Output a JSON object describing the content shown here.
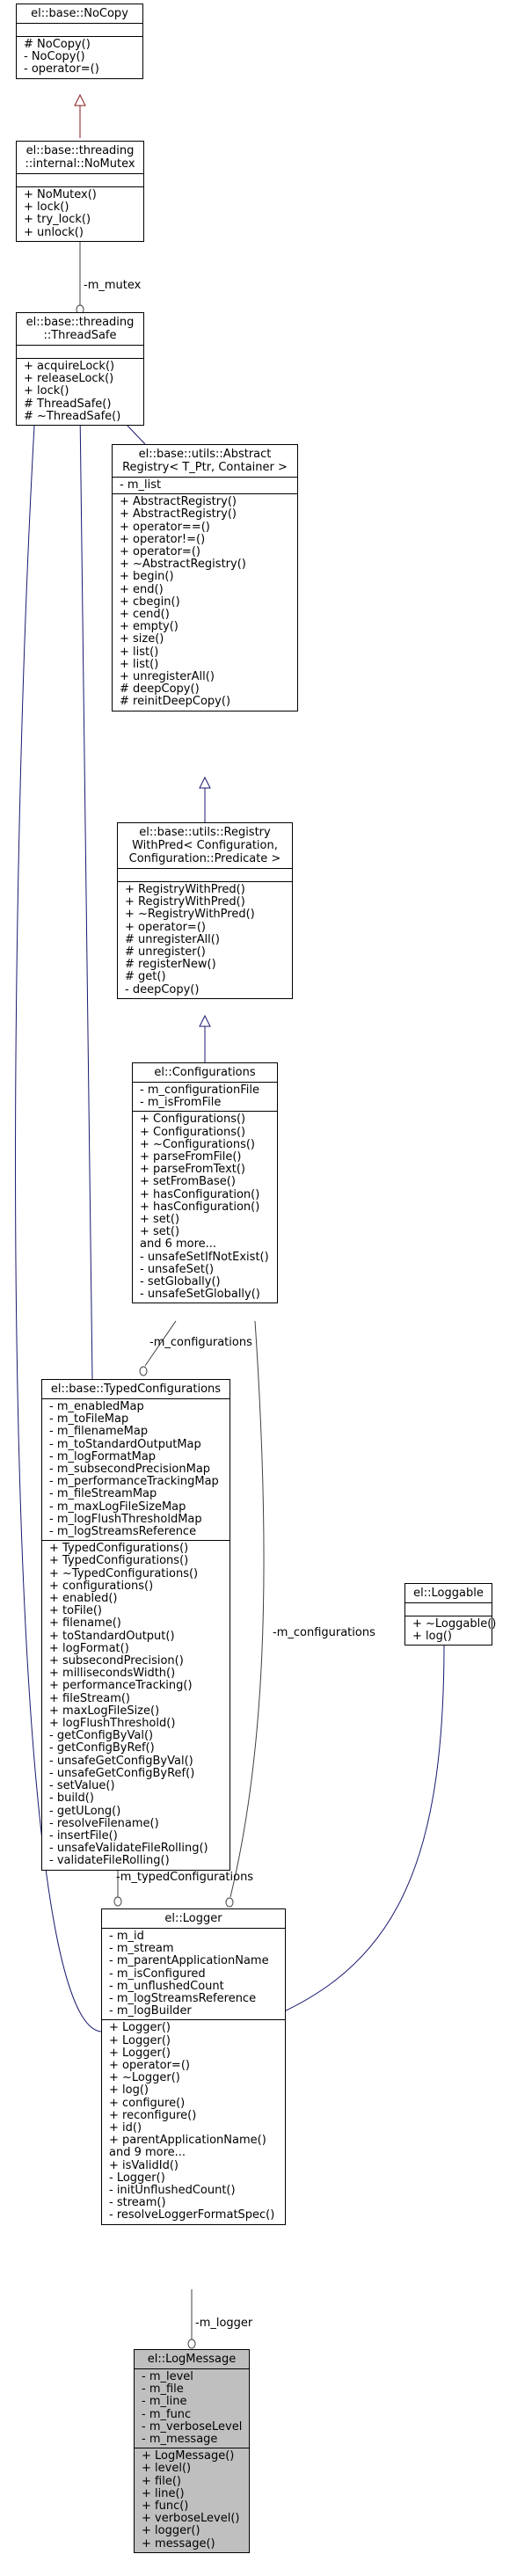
{
  "classes": {
    "nocopy": {
      "title": [
        "el::base::NoCopy"
      ],
      "attributes": [],
      "operations": [
        "# NoCopy()",
        "- NoCopy()",
        "- operator=()"
      ]
    },
    "nomutex": {
      "title": [
        "el::base::threading",
        "::internal::NoMutex"
      ],
      "attributes": [],
      "operations": [
        "+ NoMutex()",
        "+ lock()",
        "+ try_lock()",
        "+ unlock()"
      ]
    },
    "threadsafe": {
      "title": [
        "el::base::threading",
        "::ThreadSafe"
      ],
      "attributes": [],
      "operations": [
        "+ acquireLock()",
        "+ releaseLock()",
        "+ lock()",
        "# ThreadSafe()",
        "# ~ThreadSafe()"
      ]
    },
    "abstractregistry": {
      "title": [
        "el::base::utils::Abstract",
        "Registry< T_Ptr, Container >"
      ],
      "attributes": [
        "- m_list"
      ],
      "operations": [
        "+ AbstractRegistry()",
        "+ AbstractRegistry()",
        "+ operator==()",
        "+ operator!=()",
        "+ operator=()",
        "+ ~AbstractRegistry()",
        "+ begin()",
        "+ end()",
        "+ cbegin()",
        "+ cend()",
        "+ empty()",
        "+ size()",
        "+ list()",
        "+ list()",
        "+ unregisterAll()",
        "# deepCopy()",
        "# reinitDeepCopy()"
      ]
    },
    "registrywithpred": {
      "title": [
        "el::base::utils::Registry",
        "WithPred< Configuration,",
        "Configuration::Predicate >"
      ],
      "attributes": [],
      "operations": [
        "+ RegistryWithPred()",
        "+ RegistryWithPred()",
        "+ ~RegistryWithPred()",
        "+ operator=()",
        "# unregisterAll()",
        "# unregister()",
        "# registerNew()",
        "# get()",
        "- deepCopy()"
      ]
    },
    "configurations": {
      "title": [
        "el::Configurations"
      ],
      "attributes": [
        "- m_configurationFile",
        "- m_isFromFile"
      ],
      "operations": [
        "+ Configurations()",
        "+ Configurations()",
        "+ ~Configurations()",
        "+ parseFromFile()",
        "+ parseFromText()",
        "+ setFromBase()",
        "+ hasConfiguration()",
        "+ hasConfiguration()",
        "+ set()",
        "+ set()",
        "and 6 more...",
        "- unsafeSetIfNotExist()",
        "- unsafeSet()",
        "- setGlobally()",
        "- unsafeSetGlobally()"
      ]
    },
    "typedconfigurations": {
      "title": [
        "el::base::TypedConfigurations"
      ],
      "attributes": [
        "- m_enabledMap",
        "- m_toFileMap",
        "- m_filenameMap",
        "- m_toStandardOutputMap",
        "- m_logFormatMap",
        "- m_subsecondPrecisionMap",
        "- m_performanceTrackingMap",
        "- m_fileStreamMap",
        "- m_maxLogFileSizeMap",
        "- m_logFlushThresholdMap",
        "- m_logStreamsReference"
      ],
      "operations": [
        "+ TypedConfigurations()",
        "+ TypedConfigurations()",
        "+ ~TypedConfigurations()",
        "+ configurations()",
        "+ enabled()",
        "+ toFile()",
        "+ filename()",
        "+ toStandardOutput()",
        "+ logFormat()",
        "+ subsecondPrecision()",
        "+ millisecondsWidth()",
        "+ performanceTracking()",
        "+ fileStream()",
        "+ maxLogFileSize()",
        "+ logFlushThreshold()",
        "- getConfigByVal()",
        "- getConfigByRef()",
        "- unsafeGetConfigByVal()",
        "- unsafeGetConfigByRef()",
        "- setValue()",
        "- build()",
        "- getULong()",
        "- resolveFilename()",
        "- insertFile()",
        "- unsafeValidateFileRolling()",
        "- validateFileRolling()"
      ]
    },
    "loggable": {
      "title": [
        "el::Loggable"
      ],
      "attributes": [],
      "operations": [
        "+ ~Loggable()",
        "+ log()"
      ]
    },
    "logger": {
      "title": [
        "el::Logger"
      ],
      "attributes": [
        "- m_id",
        "- m_stream",
        "- m_parentApplicationName",
        "- m_isConfigured",
        "- m_unflushedCount",
        "- m_logStreamsReference",
        "- m_logBuilder"
      ],
      "operations": [
        "+ Logger()",
        "+ Logger()",
        "+ Logger()",
        "+ operator=()",
        "+ ~Logger()",
        "+ log()",
        "+ configure()",
        "+ reconfigure()",
        "+ id()",
        "+ parentApplicationName()",
        "and 9 more...",
        "+ isValidId()",
        "- Logger()",
        "- initUnflushedCount()",
        "- stream()",
        "- resolveLoggerFormatSpec()"
      ]
    },
    "logmessage": {
      "title": [
        "el::LogMessage"
      ],
      "attributes": [
        "- m_level",
        "- m_file",
        "- m_line",
        "- m_func",
        "- m_verboseLevel",
        "- m_message"
      ],
      "operations": [
        "+ LogMessage()",
        "+ level()",
        "+ file()",
        "+ line()",
        "+ func()",
        "+ verboseLevel()",
        "+ logger()",
        "+ message()"
      ]
    }
  },
  "edge_labels": {
    "m_mutex": "-m_mutex",
    "m_configurations_1": "-m_configurations",
    "m_configurations_2": "-m_configurations",
    "m_typedConfigurations": "-m_typedConfigurations",
    "m_logger": "-m_logger"
  },
  "colors": {
    "inheritance": "#191970",
    "private_inheritance": "#8b1a1a",
    "association": "#404040",
    "highlight_fill": "#bfbfbf"
  }
}
